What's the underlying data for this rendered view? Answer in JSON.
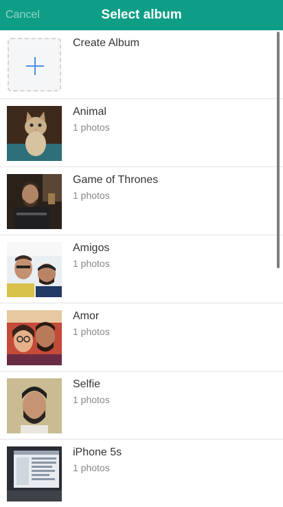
{
  "navbar": {
    "cancel_label": "Cancel",
    "title": "Select album",
    "color": "#0e9e86"
  },
  "create_album": {
    "label": "Create Album",
    "icon": "plus-icon"
  },
  "albums": [
    {
      "name": "Animal",
      "count": "1 photos"
    },
    {
      "name": "Game of Thrones",
      "count": "1 photos"
    },
    {
      "name": "Amigos",
      "count": "1 photos"
    },
    {
      "name": "Amor",
      "count": "1 photos"
    },
    {
      "name": "Selfie",
      "count": "1 photos"
    },
    {
      "name": "iPhone 5s",
      "count": "1 photos"
    }
  ]
}
